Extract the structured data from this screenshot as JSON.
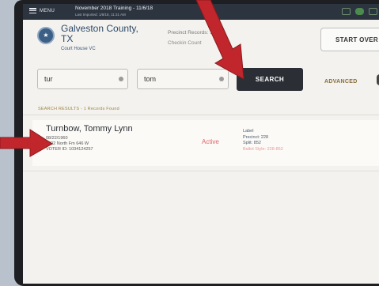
{
  "topbar": {
    "menu_label": "MENU",
    "event_title": "November 2018 Training - 11/6/18",
    "last_imported": "Last Imported: 1/8/18, 11:31 AM"
  },
  "header": {
    "county_name": "Galveston County, TX",
    "location": "Court House VC",
    "precinct_records": "Precinct Records: 1032",
    "checkin_count": "Checkin Count",
    "start_over_label": "START OVER"
  },
  "search": {
    "last_name_value": "tur",
    "first_name_value": "tom",
    "search_label": "SEARCH",
    "advanced_label": "ADVANCED"
  },
  "results": {
    "summary": "SEARCH RESULTS - 1 Records Found",
    "items": [
      {
        "name": "Turnbow, Tommy Lynn",
        "dob": "08/22/1960",
        "address": "4302 North Fm 646 W",
        "voter_id": "VOTER ID: 1034124257",
        "status": "Active",
        "label_heading": "Label",
        "precinct": "Precinct: 228",
        "split": "Split: 852",
        "ballot_style": "Ballot Style: 228-852"
      }
    ]
  },
  "colors": {
    "status_active": "#e06464",
    "search_button": "#2b2f35",
    "annotation_arrow": "#c0262c"
  },
  "icons": [
    "menu-icon",
    "county-seal-icon",
    "clear-icon",
    "wifi-icon",
    "cloud-icon",
    "battery-icon"
  ]
}
